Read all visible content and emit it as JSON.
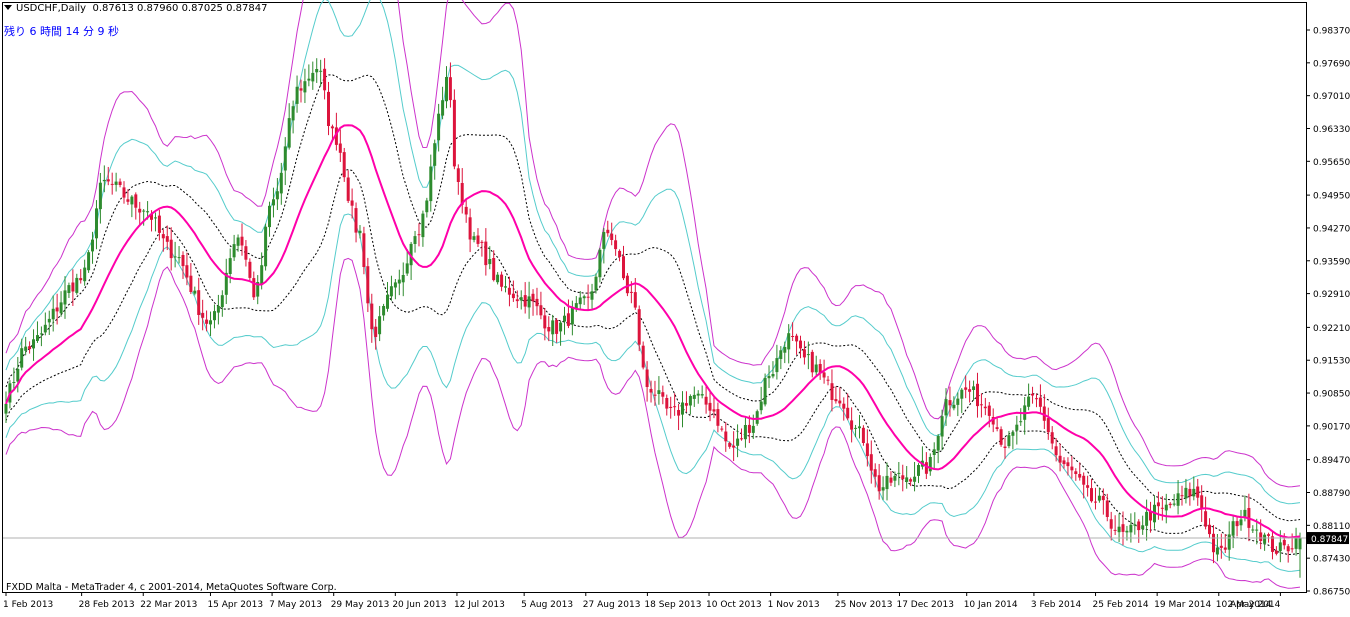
{
  "header": {
    "symbol_line": "USDCHF,Daily",
    "open": "0.87613",
    "high": "0.87960",
    "low": "0.87025",
    "close": "0.87847"
  },
  "timer_text": "残り 6 時間 14 分 9 秒",
  "copyright": "FXDD Malta - MetaTrader 4, c 2001-2014, MetaQuotes Software Corp.",
  "current_price_label": "0.87847",
  "colors": {
    "bull": "#2e8b2e",
    "bear": "#dc143c",
    "ma": "#ff00aa",
    "outer_band": "#cc33cc",
    "mid_band": "#55cccc",
    "inner_band": "#000000",
    "price_line": "#b0b0b0",
    "label_bg": "#000000"
  },
  "chart_data": {
    "type": "candlestick",
    "ylim": [
      0.8675,
      0.9875
    ],
    "y_ticks": [
      "0.98370",
      "0.97690",
      "0.97010",
      "0.96330",
      "0.95650",
      "0.94950",
      "0.94270",
      "0.93590",
      "0.92910",
      "0.92210",
      "0.91530",
      "0.90850",
      "0.90170",
      "0.89470",
      "0.88790",
      "0.88110",
      "0.87430",
      "0.86750"
    ],
    "x_tick_labels": [
      "1 Feb 2013",
      "28 Feb 2013",
      "22 Mar 2013",
      "15 Apr 2013",
      "7 May 2013",
      "29 May 2013",
      "20 Jun 2013",
      "12 Jul 2013",
      "5 Aug 2013",
      "27 Aug 2013",
      "18 Sep 2013",
      "10 Oct 2013",
      "1 Nov 2013",
      "25 Nov 2013",
      "17 Dec 2013",
      "10 Jan 2014",
      "3 Feb 2014",
      "25 Feb 2014",
      "19 Mar 2014",
      "10 Apr 2014",
      "2 May 2014"
    ],
    "indicators": [
      "Moving Average (magenta)",
      "Bands (outer, middle, inner)"
    ],
    "close_anchors": [
      {
        "date": "1 Feb 2013",
        "close": 0.908
      },
      {
        "date": "8 Feb 2013",
        "close": 0.918
      },
      {
        "date": "28 Feb 2013",
        "close": 0.932
      },
      {
        "date": "8 Mar 2013",
        "close": 0.952
      },
      {
        "date": "22 Mar 2013",
        "close": 0.947
      },
      {
        "date": "1 Apr 2013",
        "close": 0.938
      },
      {
        "date": "15 Apr 2013",
        "close": 0.923
      },
      {
        "date": "25 Apr 2013",
        "close": 0.941
      },
      {
        "date": "1 May 2013",
        "close": 0.929
      },
      {
        "date": "7 May 2013",
        "close": 0.948
      },
      {
        "date": "17 May 2013",
        "close": 0.972
      },
      {
        "date": "23 May 2013",
        "close": 0.976
      },
      {
        "date": "29 May 2013",
        "close": 0.962
      },
      {
        "date": "7 Jun 2013",
        "close": 0.942
      },
      {
        "date": "12 Jun 2013",
        "close": 0.921
      },
      {
        "date": "20 Jun 2013",
        "close": 0.93
      },
      {
        "date": "28 Jun 2013",
        "close": 0.943
      },
      {
        "date": "9 Jul 2013",
        "close": 0.973
      },
      {
        "date": "12 Jul 2013",
        "close": 0.951
      },
      {
        "date": "19 Jul 2013",
        "close": 0.939
      },
      {
        "date": "29 Jul 2013",
        "close": 0.93
      },
      {
        "date": "5 Aug 2013",
        "close": 0.928
      },
      {
        "date": "16 Aug 2013",
        "close": 0.922
      },
      {
        "date": "27 Aug 2013",
        "close": 0.927
      },
      {
        "date": "4 Sep 2013",
        "close": 0.942
      },
      {
        "date": "12 Sep 2013",
        "close": 0.929
      },
      {
        "date": "18 Sep 2013",
        "close": 0.91
      },
      {
        "date": "27 Sep 2013",
        "close": 0.904
      },
      {
        "date": "4 Oct 2013",
        "close": 0.908
      },
      {
        "date": "10 Oct 2013",
        "close": 0.906
      },
      {
        "date": "18 Oct 2013",
        "close": 0.897
      },
      {
        "date": "25 Oct 2013",
        "close": 0.902
      },
      {
        "date": "1 Nov 2013",
        "close": 0.913
      },
      {
        "date": "7 Nov 2013",
        "close": 0.92
      },
      {
        "date": "14 Nov 2013",
        "close": 0.915
      },
      {
        "date": "25 Nov 2013",
        "close": 0.908
      },
      {
        "date": "3 Dec 2013",
        "close": 0.9
      },
      {
        "date": "10 Dec 2013",
        "close": 0.889
      },
      {
        "date": "17 Dec 2013",
        "close": 0.891
      },
      {
        "date": "27 Dec 2013",
        "close": 0.893
      },
      {
        "date": "3 Jan 2014",
        "close": 0.907
      },
      {
        "date": "10 Jan 2014",
        "close": 0.909
      },
      {
        "date": "17 Jan 2014",
        "close": 0.906
      },
      {
        "date": "24 Jan 2014",
        "close": 0.898
      },
      {
        "date": "3 Feb 2014",
        "close": 0.907
      },
      {
        "date": "14 Feb 2014",
        "close": 0.893
      },
      {
        "date": "25 Feb 2014",
        "close": 0.886
      },
      {
        "date": "7 Mar 2014",
        "close": 0.879
      },
      {
        "date": "19 Mar 2014",
        "close": 0.884
      },
      {
        "date": "1 Apr 2014",
        "close": 0.888
      },
      {
        "date": "10 Apr 2014",
        "close": 0.875
      },
      {
        "date": "18 Apr 2014",
        "close": 0.883
      },
      {
        "date": "2 May 2014",
        "close": 0.876
      },
      {
        "date": "9 May 2014",
        "close": 0.8785
      }
    ]
  }
}
